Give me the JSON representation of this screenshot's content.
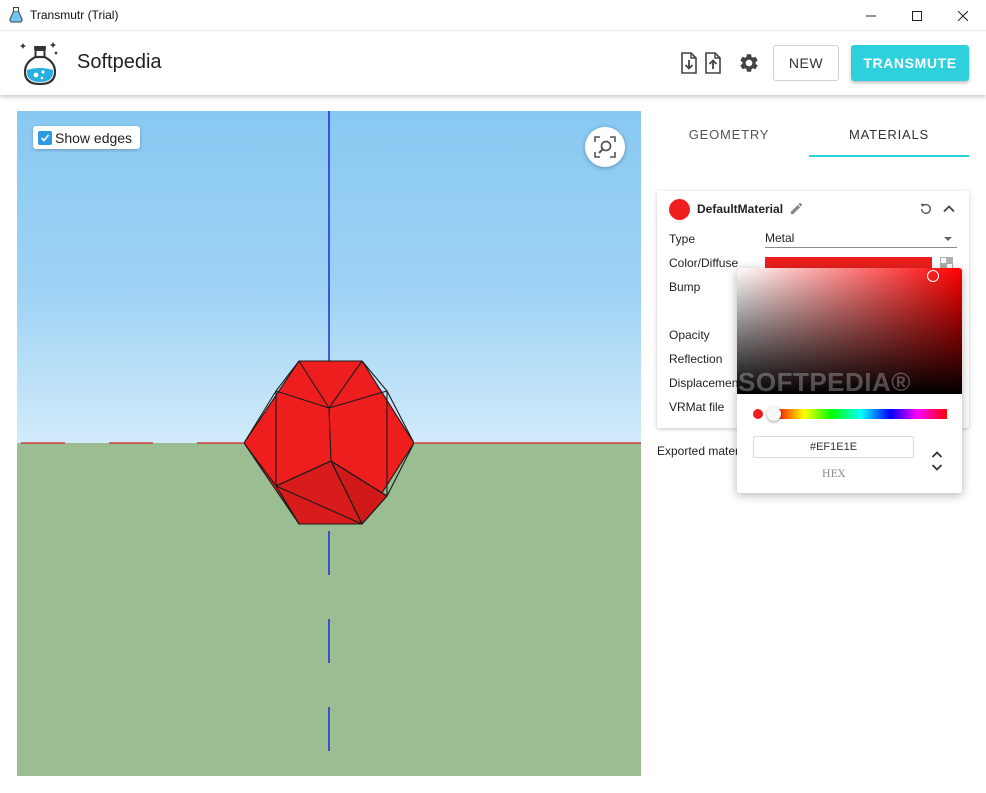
{
  "window": {
    "title": "Transmutr (Trial)"
  },
  "header": {
    "brand": "Softpedia",
    "new_label": "NEW",
    "transmute_label": "TRANSMUTE",
    "icons": [
      "import-icon",
      "export-icon",
      "gear-icon"
    ]
  },
  "viewport": {
    "show_edges_label": "Show edges",
    "show_edges_checked": true,
    "sky_color": "#9fd3f5",
    "ground_color": "#9bbd92",
    "model_color": "#ef1e1e"
  },
  "tabs": [
    {
      "label": "GEOMETRY",
      "active": false
    },
    {
      "label": "MATERIALS",
      "active": true
    }
  ],
  "material": {
    "name": "DefaultMaterial",
    "color": "#ef1e1e",
    "properties": [
      {
        "label": "Type"
      },
      {
        "label": "Color/Diffuse"
      },
      {
        "label": "Bump"
      },
      {
        "label": "Opacity"
      },
      {
        "label": "Reflection"
      },
      {
        "label": "Displacement"
      },
      {
        "label": "VRMat file"
      }
    ],
    "type_value": "Metal"
  },
  "exported_text": "Exported mater",
  "color_picker": {
    "hex_value": "#EF1E1E",
    "format_label": "HEX",
    "watermark": "SOFTPEDIA®"
  },
  "colors": {
    "accent": "#2ed0de",
    "axis_blue": "#1f2bd8",
    "axis_red": "#d41f1f"
  }
}
